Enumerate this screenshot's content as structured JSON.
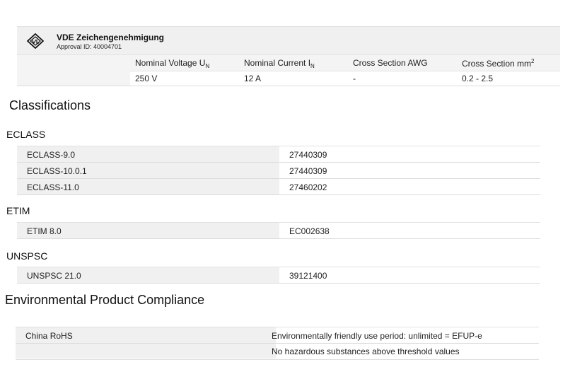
{
  "approval": {
    "title": "VDE Zeichengenehmigung",
    "approval_id": "Approval ID: 40004701",
    "columns": [
      {
        "label": "Nominal Voltage U",
        "sub": "N",
        "sup": ""
      },
      {
        "label": "Nominal Current I",
        "sub": "N",
        "sup": ""
      },
      {
        "label": "Cross Section AWG",
        "sub": "",
        "sup": ""
      },
      {
        "label": "Cross Section mm",
        "sub": "",
        "sup": "2"
      }
    ],
    "values": [
      "250 V",
      "12 A",
      "-",
      "0.2 - 2.5"
    ]
  },
  "classifications": {
    "heading": "Classifications",
    "eclass": {
      "heading": "ECLASS",
      "rows": [
        {
          "key": "ECLASS-9.0",
          "value": "27440309"
        },
        {
          "key": "ECLASS-10.0.1",
          "value": "27440309"
        },
        {
          "key": "ECLASS-11.0",
          "value": "27460202"
        }
      ]
    },
    "etim": {
      "heading": "ETIM",
      "rows": [
        {
          "key": "ETIM 8.0",
          "value": "EC002638"
        }
      ]
    },
    "unspsc": {
      "heading": "UNSPSC",
      "rows": [
        {
          "key": "UNSPSC 21.0",
          "value": "39121400"
        }
      ]
    }
  },
  "compliance": {
    "heading": "Environmental Product Compliance",
    "key": "China RoHS",
    "values": [
      "Environmentally friendly use period: unlimited = EFUP-e",
      "No hazardous substances above threshold values"
    ]
  }
}
